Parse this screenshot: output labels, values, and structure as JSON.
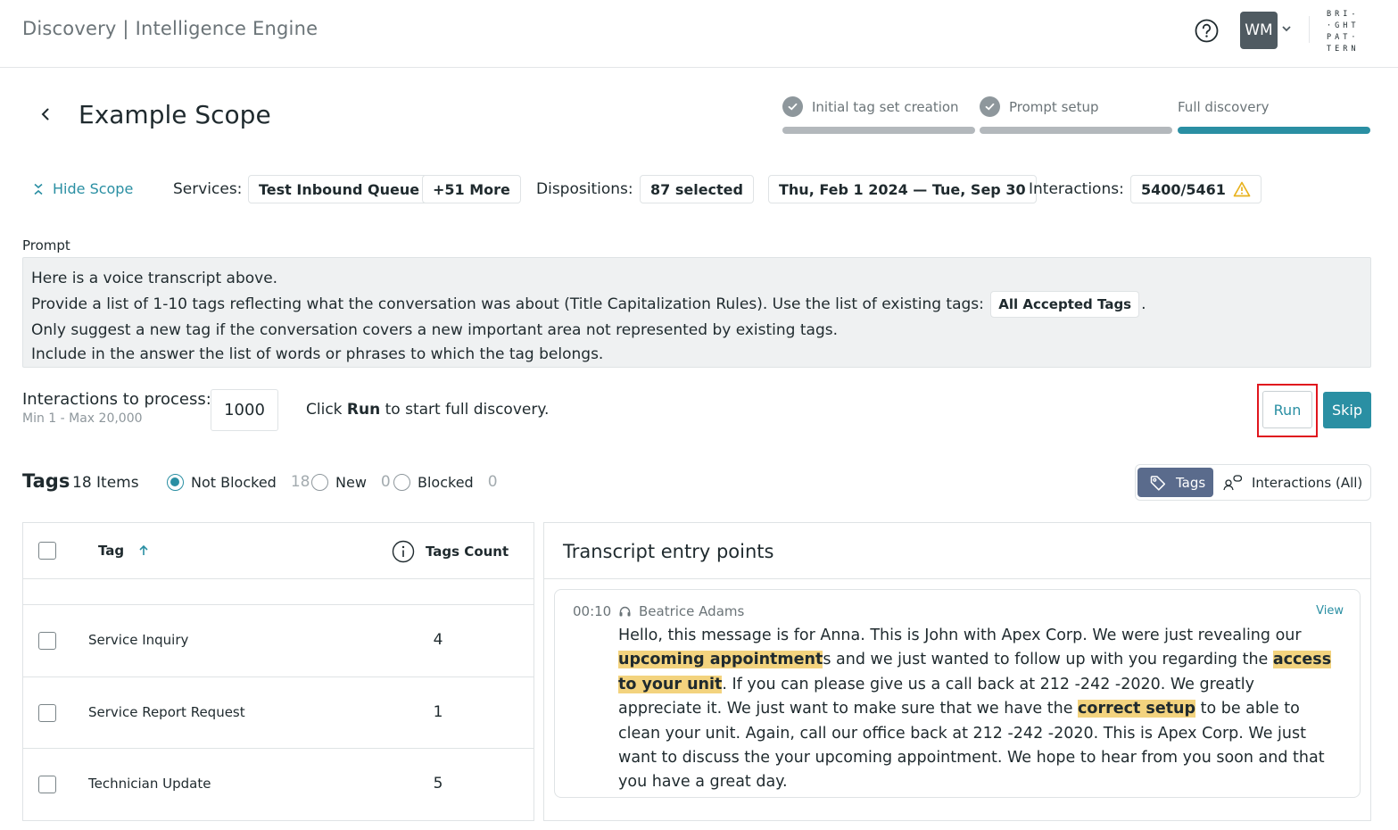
{
  "app": {
    "title": "Discovery | Intelligence Engine",
    "avatar_initials": "WM",
    "brand_lines": [
      "BRI-",
      "·GHT",
      "PAT·",
      "TERN"
    ]
  },
  "header": {
    "title": "Example Scope"
  },
  "steps": [
    {
      "label": "Initial tag set creation",
      "status": "done"
    },
    {
      "label": "Prompt setup",
      "status": "done"
    },
    {
      "label": "Full discovery",
      "status": "active"
    }
  ],
  "scope": {
    "hide_label": "Hide Scope",
    "services_label": "Services:",
    "service_chip": "Test Inbound Queue",
    "more_chip": "+51 More",
    "dispositions_label": "Dispositions:",
    "dispositions_chip": "87 selected",
    "date_chip": "Thu, Feb 1 2024 — Tue, Sep 30",
    "interactions_label": "Interactions:",
    "interactions_chip": "5400/5461"
  },
  "prompt": {
    "label": "Prompt",
    "line1": "Here is a voice transcript above.",
    "line2_pre": "Provide a list of 1-10 tags reflecting what the conversation was about (Title Capitalization Rules). Use the list of existing tags:",
    "line2_chip": "All Accepted Tags",
    "line2_post": ".",
    "line3": "Only suggest a new tag if the conversation covers a new important area not represented by existing tags.",
    "line4": "Include in the answer the list of words or phrases to which the tag belongs."
  },
  "process": {
    "label": "Interactions to process:",
    "sub": "Min 1 - Max 20,000",
    "value": "1000",
    "hint_pre": "Click ",
    "hint_bold": "Run",
    "hint_post": " to start full discovery.",
    "run_label": "Run",
    "skip_label": "Skip"
  },
  "tags": {
    "title": "Tags",
    "count_label": "18 Items",
    "filters": [
      {
        "label": "Not Blocked",
        "count": "18",
        "selected": true
      },
      {
        "label": "New",
        "count": "0",
        "selected": false
      },
      {
        "label": "Blocked",
        "count": "0",
        "selected": false
      }
    ],
    "toggle": {
      "tags_label": "Tags",
      "interactions_label": "Interactions (All)"
    },
    "columns": {
      "tag": "Tag",
      "count": "Tags Count"
    },
    "rows": [
      {
        "name": "Service Inquiry",
        "count": "4"
      },
      {
        "name": "Service Report Request",
        "count": "1"
      },
      {
        "name": "Technician Update",
        "count": "5"
      }
    ]
  },
  "transcript": {
    "title": "Transcript entry points",
    "entry": {
      "time": "00:10",
      "agent": "Beatrice Adams",
      "view_label": "View",
      "segments": [
        {
          "text": "Hello, this message is for Anna. This is John with Apex Corp. We were just revealing our ",
          "highlight": false
        },
        {
          "text": "upcoming appointment",
          "highlight": true
        },
        {
          "text": "s and we just wanted to follow up with you regarding the ",
          "highlight": false
        },
        {
          "text": "access to your unit",
          "highlight": true
        },
        {
          "text": ". If you can please give us a call back at 212 -242 -2020. We greatly appreciate it. We just want to make sure that we have the ",
          "highlight": false
        },
        {
          "text": "correct setup",
          "highlight": true
        },
        {
          "text": " to be able to clean your unit. Again, call our office back at 212 -242 -2020. This is Apex Corp. We just want to discuss the your upcoming appointment. We hope to hear from you soon and that you have a great day.",
          "highlight": false
        }
      ]
    }
  },
  "colors": {
    "accent": "#2a8fa3",
    "highlight": "#f3d37e",
    "toggle_active": "#5a6b8c",
    "run_frame": "#e0161e"
  },
  "icons": [
    "help-icon",
    "chevron-down-icon",
    "back-arrow-icon",
    "check-icon",
    "collapse-icon",
    "warning-icon",
    "tag-icon",
    "interactions-icon",
    "sort-up-icon",
    "info-icon",
    "headset-icon"
  ]
}
